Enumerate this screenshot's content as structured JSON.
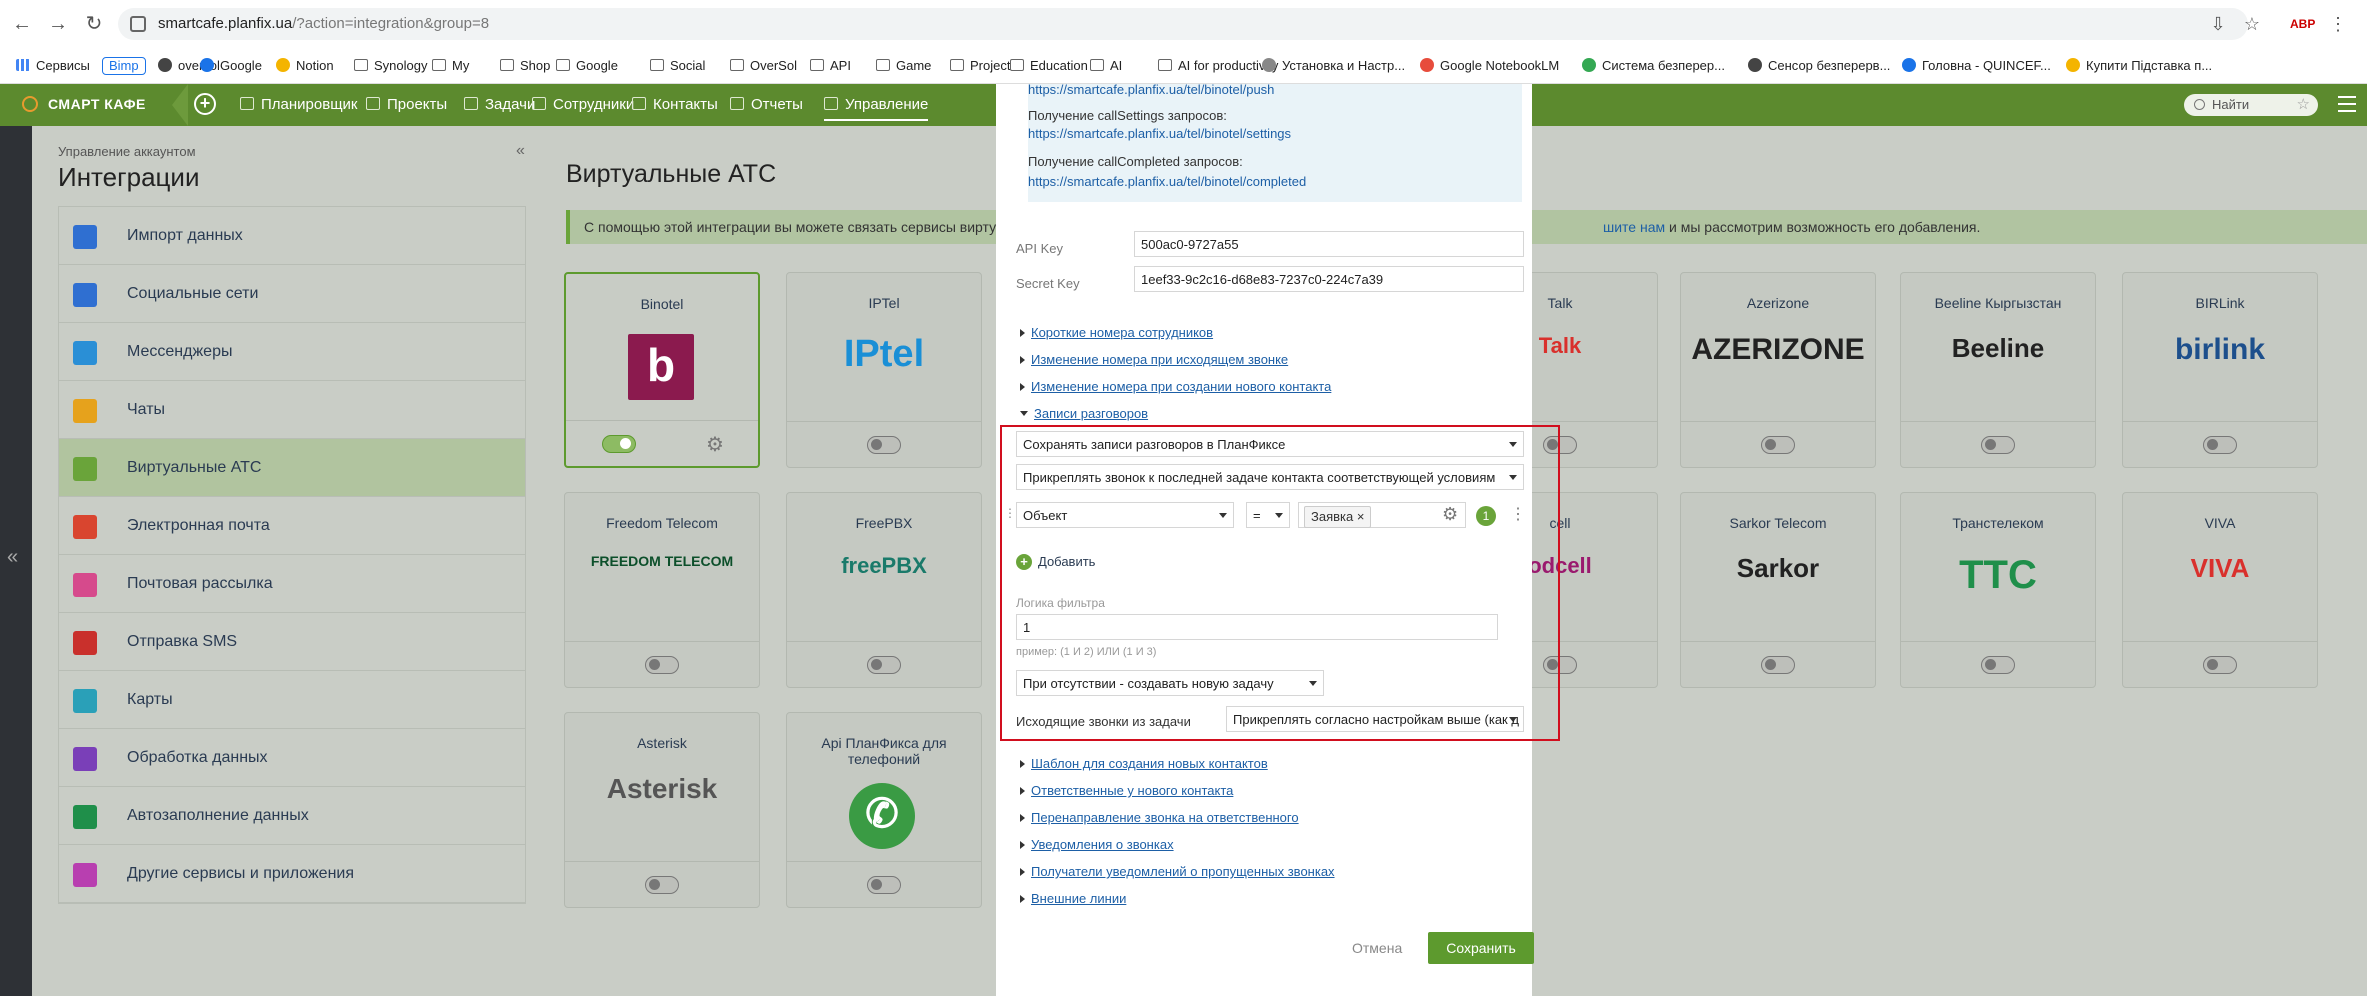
{
  "browser": {
    "url_host": "smartcafe.planfix.ua",
    "url_path": "/?action=integration&group=8",
    "bookmarks": [
      {
        "label": "Сервисы",
        "type": "apps"
      },
      {
        "label": "Bimp",
        "type": "pill"
      },
      {
        "label": "oversol",
        "type": "site"
      },
      {
        "label": "Google",
        "type": "site"
      },
      {
        "label": "Notion",
        "type": "site"
      },
      {
        "label": "Synology",
        "type": "folder"
      },
      {
        "label": "My",
        "type": "folder"
      },
      {
        "label": "Shop",
        "type": "folder"
      },
      {
        "label": "Google",
        "type": "folder"
      },
      {
        "label": "Social",
        "type": "folder"
      },
      {
        "label": "OverSol",
        "type": "folder"
      },
      {
        "label": "API",
        "type": "folder"
      },
      {
        "label": "Game",
        "type": "folder"
      },
      {
        "label": "Project",
        "type": "folder"
      },
      {
        "label": "Education",
        "type": "folder"
      },
      {
        "label": "AI",
        "type": "folder"
      },
      {
        "label": "AI for productivity",
        "type": "folder"
      },
      {
        "label": "Установка и Настр...",
        "type": "site"
      },
      {
        "label": "Google NotebookLM",
        "type": "site"
      },
      {
        "label": "Система безперер...",
        "type": "site"
      },
      {
        "label": "Сенсор безперерв...",
        "type": "site"
      },
      {
        "label": "Головна - QUINCEF...",
        "type": "site"
      },
      {
        "label": "Купити Підставка п...",
        "type": "site"
      }
    ]
  },
  "appbar": {
    "logo": "СМАРТ КАФЕ",
    "menu": [
      "Планировщик",
      "Проекты",
      "Задачи",
      "Сотрудники",
      "Контакты",
      "Отчеты",
      "Управление"
    ],
    "search_placeholder": "Найти"
  },
  "sidebar": {
    "breadcrumb": "Управление аккаунтом",
    "title": "Интеграции",
    "items": [
      {
        "label": "Импорт данных",
        "color": "#2f6fd1"
      },
      {
        "label": "Социальные сети",
        "color": "#2f6fd1"
      },
      {
        "label": "Мессенджеры",
        "color": "#2a8fd6"
      },
      {
        "label": "Чаты",
        "color": "#e6a21c"
      },
      {
        "label": "Виртуальные АТС",
        "color": "#6aa43a"
      },
      {
        "label": "Электронная почта",
        "color": "#d9452f"
      },
      {
        "label": "Почтовая рассылка",
        "color": "#d64a8c"
      },
      {
        "label": "Отправка SMS",
        "color": "#c9302c"
      },
      {
        "label": "Карты",
        "color": "#2aa0b8"
      },
      {
        "label": "Обработка данных",
        "color": "#7a3fb8"
      },
      {
        "label": "Автозаполнение данных",
        "color": "#1f8f4a"
      },
      {
        "label": "Другие сервисы и приложения",
        "color": "#b83fb0"
      }
    ]
  },
  "main": {
    "title": "Виртуальные АТС",
    "info_left": "С помощью этой интеграции вы можете связать сервисы виртуа",
    "info_link": "шите нам",
    "info_right": " и мы рассмотрим возможность его добавления.",
    "cards": [
      {
        "name": "Binotel",
        "logo": "b",
        "on": true
      },
      {
        "name": "IPTel",
        "logo": "IPtel",
        "on": false
      },
      {
        "name": "Talk",
        "logo": "Talk",
        "on": false
      },
      {
        "name": "Azerizone",
        "logo": "AZERIZONE",
        "on": false
      },
      {
        "name": "Beeline Кыргызстан",
        "logo": "Beeline",
        "on": false
      },
      {
        "name": "BIRLink",
        "logo": "birlink",
        "on": false
      },
      {
        "name": "Freedom Telecom",
        "logo": "FREEDOM TELECOM",
        "on": false
      },
      {
        "name": "FreePBX",
        "logo": "freePBX",
        "on": false
      },
      {
        "name": "cell",
        "logo": "odcell",
        "on": false
      },
      {
        "name": "Sarkor Telecom",
        "logo": "Sarkor",
        "on": false
      },
      {
        "name": "Транстелеком",
        "logo": "TTC",
        "on": false
      },
      {
        "name": "VIVA",
        "logo": "VIVA",
        "on": false
      },
      {
        "name": "Asterisk",
        "logo": "Asterisk",
        "on": false
      },
      {
        "name": "Api ПланФикса для телефоний",
        "logo": "✆",
        "on": false
      }
    ]
  },
  "modal": {
    "push_url": "https://smartcafe.planfix.ua/tel/binotel/push",
    "settings_label": "Получение callSettings запросов:",
    "settings_url": "https://smartcafe.planfix.ua/tel/binotel/settings",
    "completed_label": "Получение callCompleted запросов:",
    "completed_url": "https://smartcafe.planfix.ua/tel/binotel/completed",
    "api_key_label": "API Key",
    "api_key": "500ac0-9727a55",
    "secret_key_label": "Secret Key",
    "secret_key": "1eef33-9c2c16-d68e83-7237c0-224c7a39",
    "sections_top": [
      "Короткие номера сотрудников",
      "Изменение номера при исходящем звонке",
      "Изменение номера при создании нового контакта"
    ],
    "records_section": "Записи разговоров",
    "save_records": "Сохранять записи разговоров в ПланФиксе",
    "attach_call": "Прикреплять звонок к последней задаче контакта соответствующей условиям",
    "filter_field": "Объект",
    "filter_op": "=",
    "filter_value": "Заявка",
    "filter_count": "1",
    "add_label": "Добавить",
    "logic_label": "Логика фильтра",
    "logic_value": "1",
    "logic_hint": "пример: (1 И 2) ИЛИ (1 И 3)",
    "absent_action": "При отсутствии - создавать новую задачу",
    "outgoing_label": "Исходящие звонки из задачи",
    "outgoing_value": "Прикреплять согласно настройкам выше (как д",
    "sections_bottom": [
      "Шаблон для создания новых контактов",
      "Ответственные у нового контакта",
      "Перенаправление звонка на ответственного",
      "Уведомления о звонках",
      "Получатели уведомлений о пропущенных звонках",
      "Внешние линии"
    ],
    "cancel": "Отмена",
    "save": "Сохранить"
  }
}
